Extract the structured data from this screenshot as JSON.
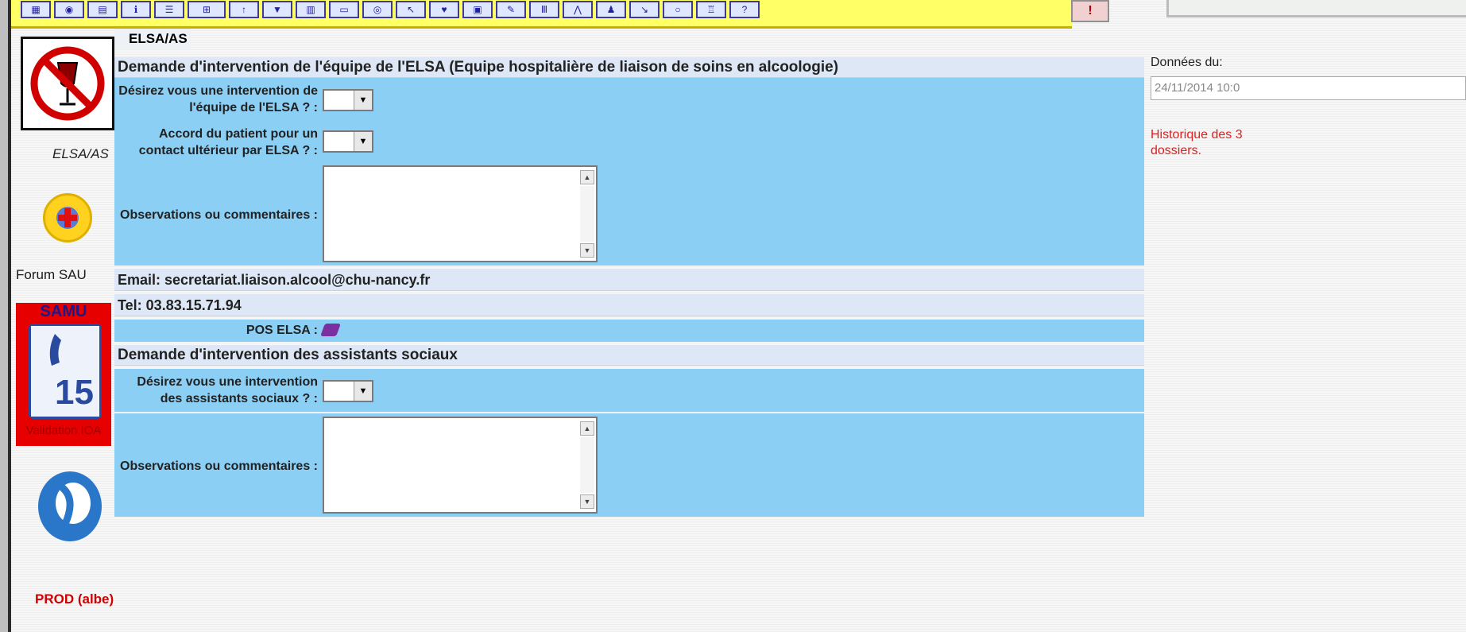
{
  "toolbar": {
    "buttons": [
      "tool-1",
      "tool-2",
      "tool-3",
      "tool-4",
      "tool-5",
      "tool-6",
      "tool-7",
      "tool-8",
      "tool-9",
      "tool-10",
      "tool-11",
      "tool-12",
      "tool-13",
      "tool-14",
      "tool-15",
      "tool-16",
      "tool-17",
      "tool-18",
      "tool-19",
      "tool-20",
      "tool-21",
      "tool-22",
      "tool-23",
      "tool-24"
    ]
  },
  "sidebar": {
    "elsa_label": "ELSA/AS",
    "forum_label": "Forum SAU",
    "samu_title": "SAMU",
    "samu_number": "15",
    "samu_sub": "Validation IOA",
    "prod_label": "PROD (albe)"
  },
  "form": {
    "tab_label": "ELSA/AS",
    "elsa_header": "Demande d'intervention de l'équipe de l'ELSA (Equipe hospitalière de liaison de soins en alcoologie)",
    "elsa_q1_label": "Désirez vous une intervention de l'équipe de l'ELSA ? :",
    "elsa_q1_value": "",
    "elsa_q2_label": "Accord du patient pour un contact ultérieur par ELSA ? :",
    "elsa_q2_value": "",
    "elsa_obs_label": "Observations ou commentaires :",
    "elsa_obs_value": "",
    "email": "Email: secretariat.liaison.alcool@chu-nancy.fr",
    "tel": "Tel: 03.83.15.71.94",
    "pos_label": "POS ELSA :",
    "as_header": "Demande d'intervention des assistants sociaux",
    "as_q1_label": "Désirez vous une intervention des assistants sociaux ? :",
    "as_q1_value": "",
    "as_obs_label": "Observations ou commentaires :",
    "as_obs_value": ""
  },
  "right_panel": {
    "donnees_label": "Données du:",
    "donnees_value": "24/11/2014 10:0",
    "historique": "Historique des 3 dossiers."
  },
  "colors": {
    "toolbar": "#ffff66",
    "row_blue": "#8ccff5",
    "header_row": "#dde7f5",
    "samu_red": "#e60000",
    "historique_red": "#e02020"
  }
}
